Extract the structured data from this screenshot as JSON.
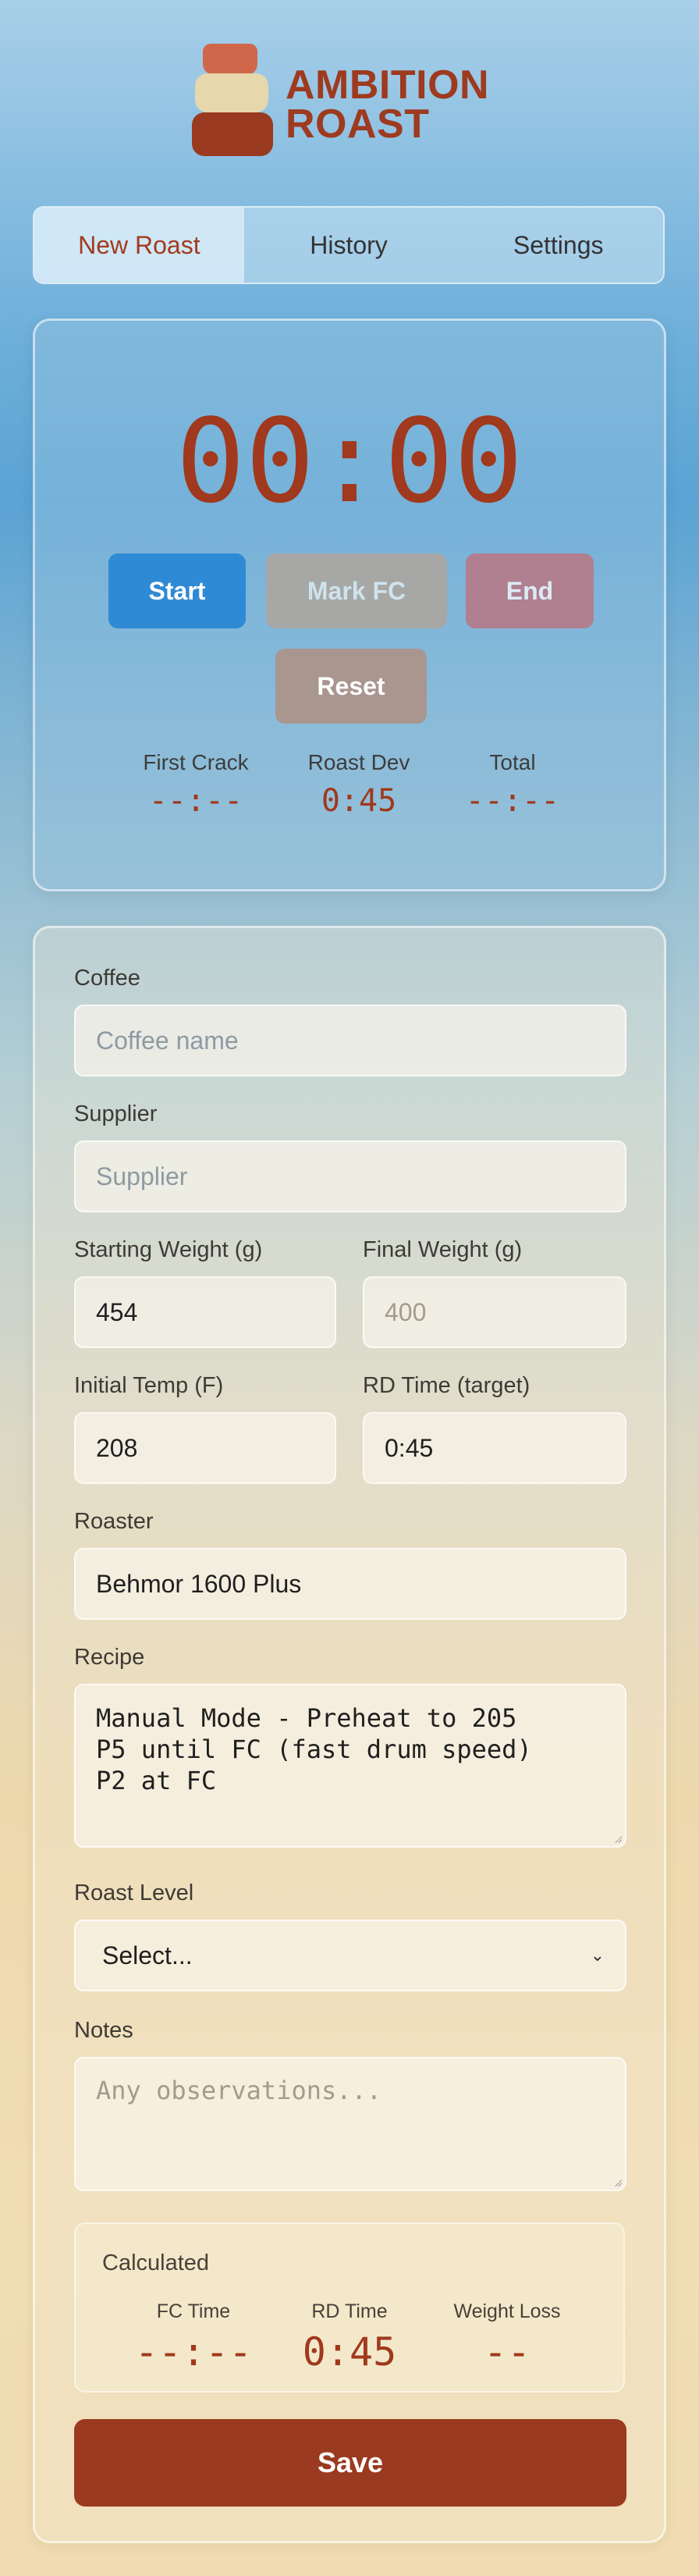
{
  "app": {
    "logo_line1": "AMBITION",
    "logo_line2": "ROAST"
  },
  "tabs": [
    {
      "label": "New Roast",
      "active": true
    },
    {
      "label": "History",
      "active": false
    },
    {
      "label": "Settings",
      "active": false
    }
  ],
  "timer": {
    "display": "00:00",
    "buttons": {
      "start": "Start",
      "mark_fc": "Mark FC",
      "end": "End",
      "reset": "Reset"
    },
    "stats": [
      {
        "label": "First Crack",
        "value": "--:--"
      },
      {
        "label": "Roast Dev",
        "value": "0:45"
      },
      {
        "label": "Total",
        "value": "--:--"
      }
    ]
  },
  "form": {
    "coffee": {
      "label": "Coffee",
      "value": "",
      "placeholder": "Coffee name"
    },
    "supplier": {
      "label": "Supplier",
      "value": "",
      "placeholder": "Supplier"
    },
    "starting_weight": {
      "label": "Starting Weight (g)",
      "value": "454"
    },
    "final_weight": {
      "label": "Final Weight (g)",
      "value": "",
      "placeholder": "400"
    },
    "initial_temp": {
      "label": "Initial Temp (F)",
      "value": "208"
    },
    "rd_time": {
      "label": "RD Time (target)",
      "value": "0:45"
    },
    "roaster": {
      "label": "Roaster",
      "value": "Behmor 1600 Plus"
    },
    "recipe": {
      "label": "Recipe",
      "value": "Manual Mode - Preheat to 205\nP5 until FC (fast drum speed)\nP2 at FC"
    },
    "roast_level": {
      "label": "Roast Level",
      "selected": "Select..."
    },
    "notes": {
      "label": "Notes",
      "value": "",
      "placeholder": "Any observations..."
    }
  },
  "calculated": {
    "title": "Calculated",
    "stats": [
      {
        "label": "FC Time",
        "value": "--:--"
      },
      {
        "label": "RD Time",
        "value": "0:45"
      },
      {
        "label": "Weight Loss",
        "value": "--"
      }
    ]
  },
  "save_label": "Save",
  "colors": {
    "accent": "#a0391d",
    "primary_button": "#2f8ad6",
    "save_button": "#9a3a20"
  }
}
